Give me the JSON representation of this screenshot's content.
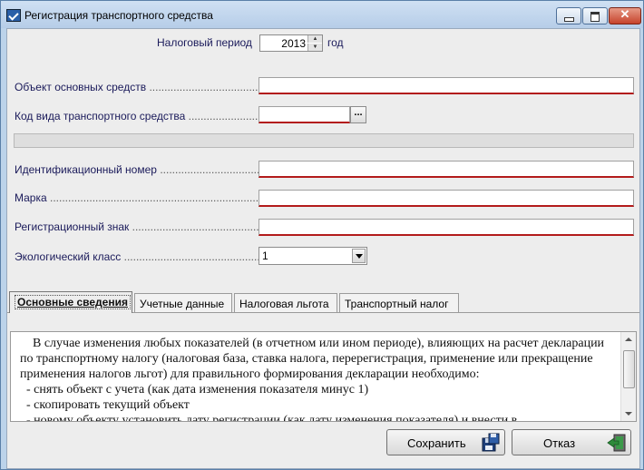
{
  "window": {
    "title": "Регистрация транспортного средства"
  },
  "colors": {
    "required_underline": "#b31b1b",
    "label_text": "#1a1a5a",
    "titlebar": "#c4d8ee"
  },
  "icons": [
    "app-icon",
    "minimize-icon",
    "maximize-icon",
    "close-icon",
    "ellipsis-icon",
    "dropdown-arrow-icon",
    "save-disk-icon",
    "exit-door-icon"
  ],
  "period": {
    "label": "Налоговый период",
    "year": "2013",
    "unit": "год"
  },
  "form": {
    "asset": {
      "label": "Объект основных средств",
      "dots": "..........................................",
      "value": ""
    },
    "vehicle_type": {
      "label": "Код вида транспортного средства",
      "dots": "..........................",
      "value": "",
      "browse": "..."
    },
    "vin": {
      "label": "Идентификационный номер",
      "dots": ".........................................",
      "value": ""
    },
    "brand": {
      "label": "Марка",
      "dots": ".................................................................................",
      "value": ""
    },
    "reg_sign": {
      "label": "Регистрационный знак",
      "dots": "....................................................",
      "value": ""
    },
    "eco_class": {
      "label": "Экологический класс",
      "dots": "......................................................",
      "value": "1"
    }
  },
  "tabs": [
    {
      "label": "Основные сведения"
    },
    {
      "label": "Учетные данные"
    },
    {
      "label": "Налоговая льгота"
    },
    {
      "label": "Транспортный налог"
    }
  ],
  "memo": {
    "text": "    В случае изменения любых показателей (в отчетном или ином периоде), влияющих на расчет декларации по транспортному налогу (налоговая база, ставка налога, перерегистрация, применение или прекращение применения налогов льгот) для правильного формирования декларации необходимо:\n  - снять объект с учета (как дата изменения показателя минус 1)\n  - скопировать текущий объект\n  - новому объекту установить дату регистрации (как дату изменения показателя) и внести в"
  },
  "buttons": {
    "save": "Сохранить",
    "cancel": "Отказ"
  }
}
